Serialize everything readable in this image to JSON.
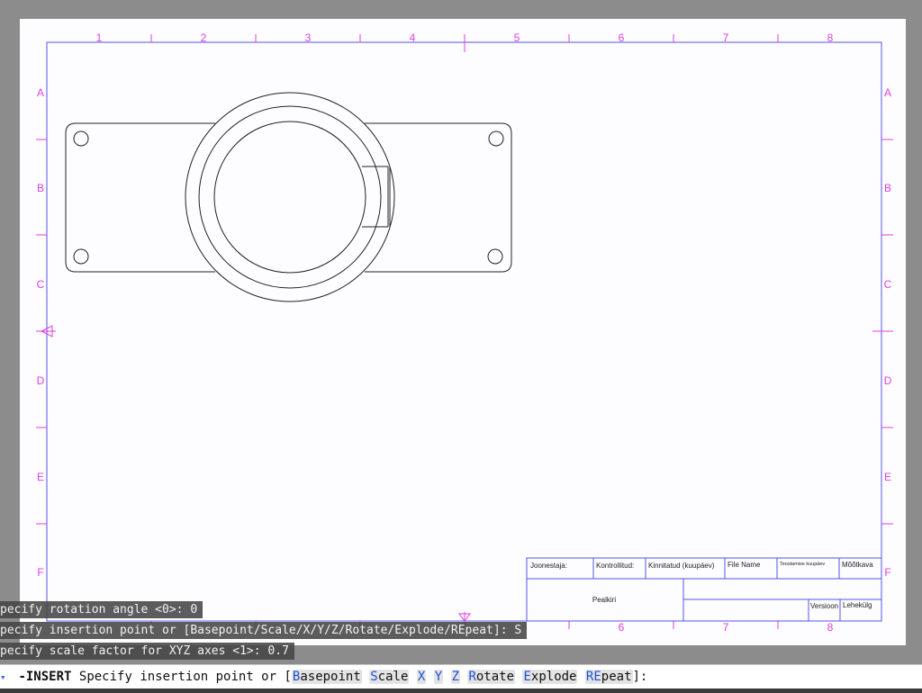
{
  "sheet": {
    "column_labels": [
      "1",
      "2",
      "3",
      "4",
      "5",
      "6",
      "7",
      "8"
    ],
    "row_labels": [
      "A",
      "B",
      "C",
      "D",
      "E",
      "F"
    ],
    "colors": {
      "frame": "#5555e6",
      "labels": "#e040e0",
      "geometry": "#222222"
    }
  },
  "title_block": {
    "drawn_by": "Joonestaja:",
    "checked_by": "Kontrollitud:",
    "approved_date": "Kinnitatud (kuupäev)",
    "file_name": "File Name",
    "creation_date": "Teostamise kuupäev",
    "scale": "Mõõtkava",
    "title": "Pealkiri",
    "version": "Versioon",
    "page": "Lehekülg"
  },
  "history": {
    "line1": "pecify rotation angle <0>: 0",
    "line2": "pecify insertion point or [Basepoint/Scale/X/Y/Z/Rotate/Explode/REpeat]: S",
    "line3": "pecify scale factor for XYZ axes <1>: 0.7"
  },
  "command_line": {
    "icon": "command-history-icon",
    "command": "-INSERT",
    "prompt": "Specify insertion point or [",
    "options": [
      {
        "hot": "B",
        "rest": "asepoint"
      },
      {
        "hot": "S",
        "rest": "cale"
      },
      {
        "hot": "X",
        "rest": ""
      },
      {
        "hot": "Y",
        "rest": ""
      },
      {
        "hot": "Z",
        "rest": ""
      },
      {
        "hot": "R",
        "rest": "otate"
      },
      {
        "hot": "E",
        "rest": "xplode"
      },
      {
        "hot": "RE",
        "rest": "peat"
      }
    ],
    "suffix": "]:"
  }
}
